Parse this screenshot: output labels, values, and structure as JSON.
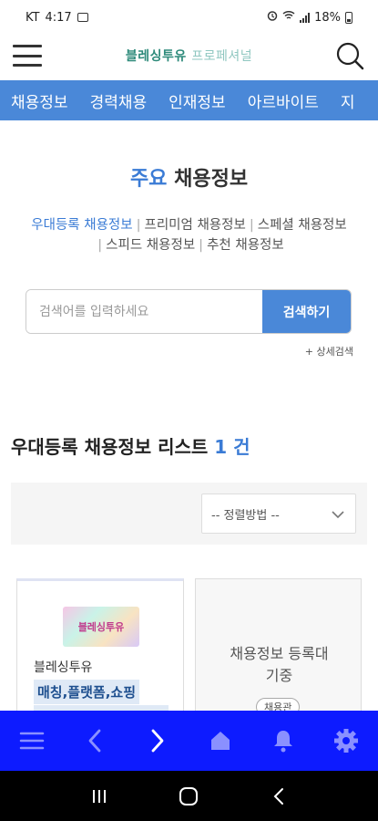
{
  "status": {
    "carrier": "KT",
    "time": "4:17",
    "battery": "18%"
  },
  "app": {
    "logo_main": "블레싱투유",
    "logo_sub": "프로페셔널"
  },
  "nav": {
    "items": [
      "채용정보",
      "경력채용",
      "인재정보",
      "아르바이트",
      "지"
    ]
  },
  "section": {
    "title_accent": "주요",
    "title_rest": "채용정보"
  },
  "categories": [
    "우대등록 채용정보",
    "프리미엄 채용정보",
    "스페셜 채용정보",
    "스피드 채용정보",
    "추천 채용정보"
  ],
  "search": {
    "placeholder": "검색어를 입력하세요",
    "button": "검색하기",
    "advanced": "+ 상세검색"
  },
  "list": {
    "title": "우대등록 채용정보 리스트",
    "count": "1 건"
  },
  "sort": {
    "label": "-- 정렬방법 --"
  },
  "cards": [
    {
      "logo_text": "블레싱투유",
      "company": "블레싱투유",
      "job": "매칭,플랫폼,쇼핑"
    },
    {
      "text_line1": "채용정보 등록대",
      "text_line2": "기중",
      "tag": "채용관"
    }
  ],
  "icons": {
    "status": [
      "gallery-icon",
      "alarm-icon",
      "wifi-icon",
      "signal-icon",
      "battery-icon"
    ],
    "toolbar": [
      "menu-icon",
      "back-arrow-icon",
      "forward-arrow-icon",
      "home-icon",
      "bell-icon",
      "settings-gear-icon"
    ],
    "system": [
      "recent-apps-icon",
      "home-circle-icon",
      "system-back-icon"
    ]
  },
  "colors": {
    "accent": "#4a88d8",
    "title_blue": "#3a7bd5",
    "toolbar": "#0d1bff",
    "logo_green": "#2d8a7a"
  }
}
